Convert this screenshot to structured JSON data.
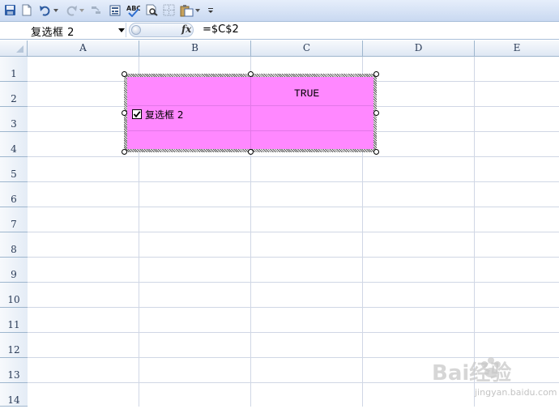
{
  "toolbar": {
    "icons": [
      "save-icon",
      "new-file-icon",
      "undo-icon",
      "undo-dropdown-icon",
      "redo-icon",
      "redo-dropdown-icon",
      "sort-icon",
      "form-icon",
      "spell-check-icon",
      "print-preview-icon",
      "borders-icon",
      "paste-icon",
      "paste-dropdown-icon",
      "customize-toolbar-icon"
    ]
  },
  "formula_bar": {
    "name_box_value": "复选框 2",
    "fx_label": "fx",
    "formula": "=$C$2"
  },
  "grid": {
    "columns": [
      "A",
      "B",
      "C",
      "D",
      "E"
    ],
    "rows": [
      "1",
      "2",
      "3",
      "4",
      "5",
      "6",
      "7",
      "8",
      "9",
      "10",
      "11",
      "12",
      "13",
      "14"
    ],
    "cell_C2": "TRUE"
  },
  "checkbox_control": {
    "label": "复选框 2",
    "checked": true,
    "fill_color": "#ff88ff"
  },
  "watermark": {
    "logo_text": "Bai经验",
    "url": "jingyan.baidu.com"
  }
}
